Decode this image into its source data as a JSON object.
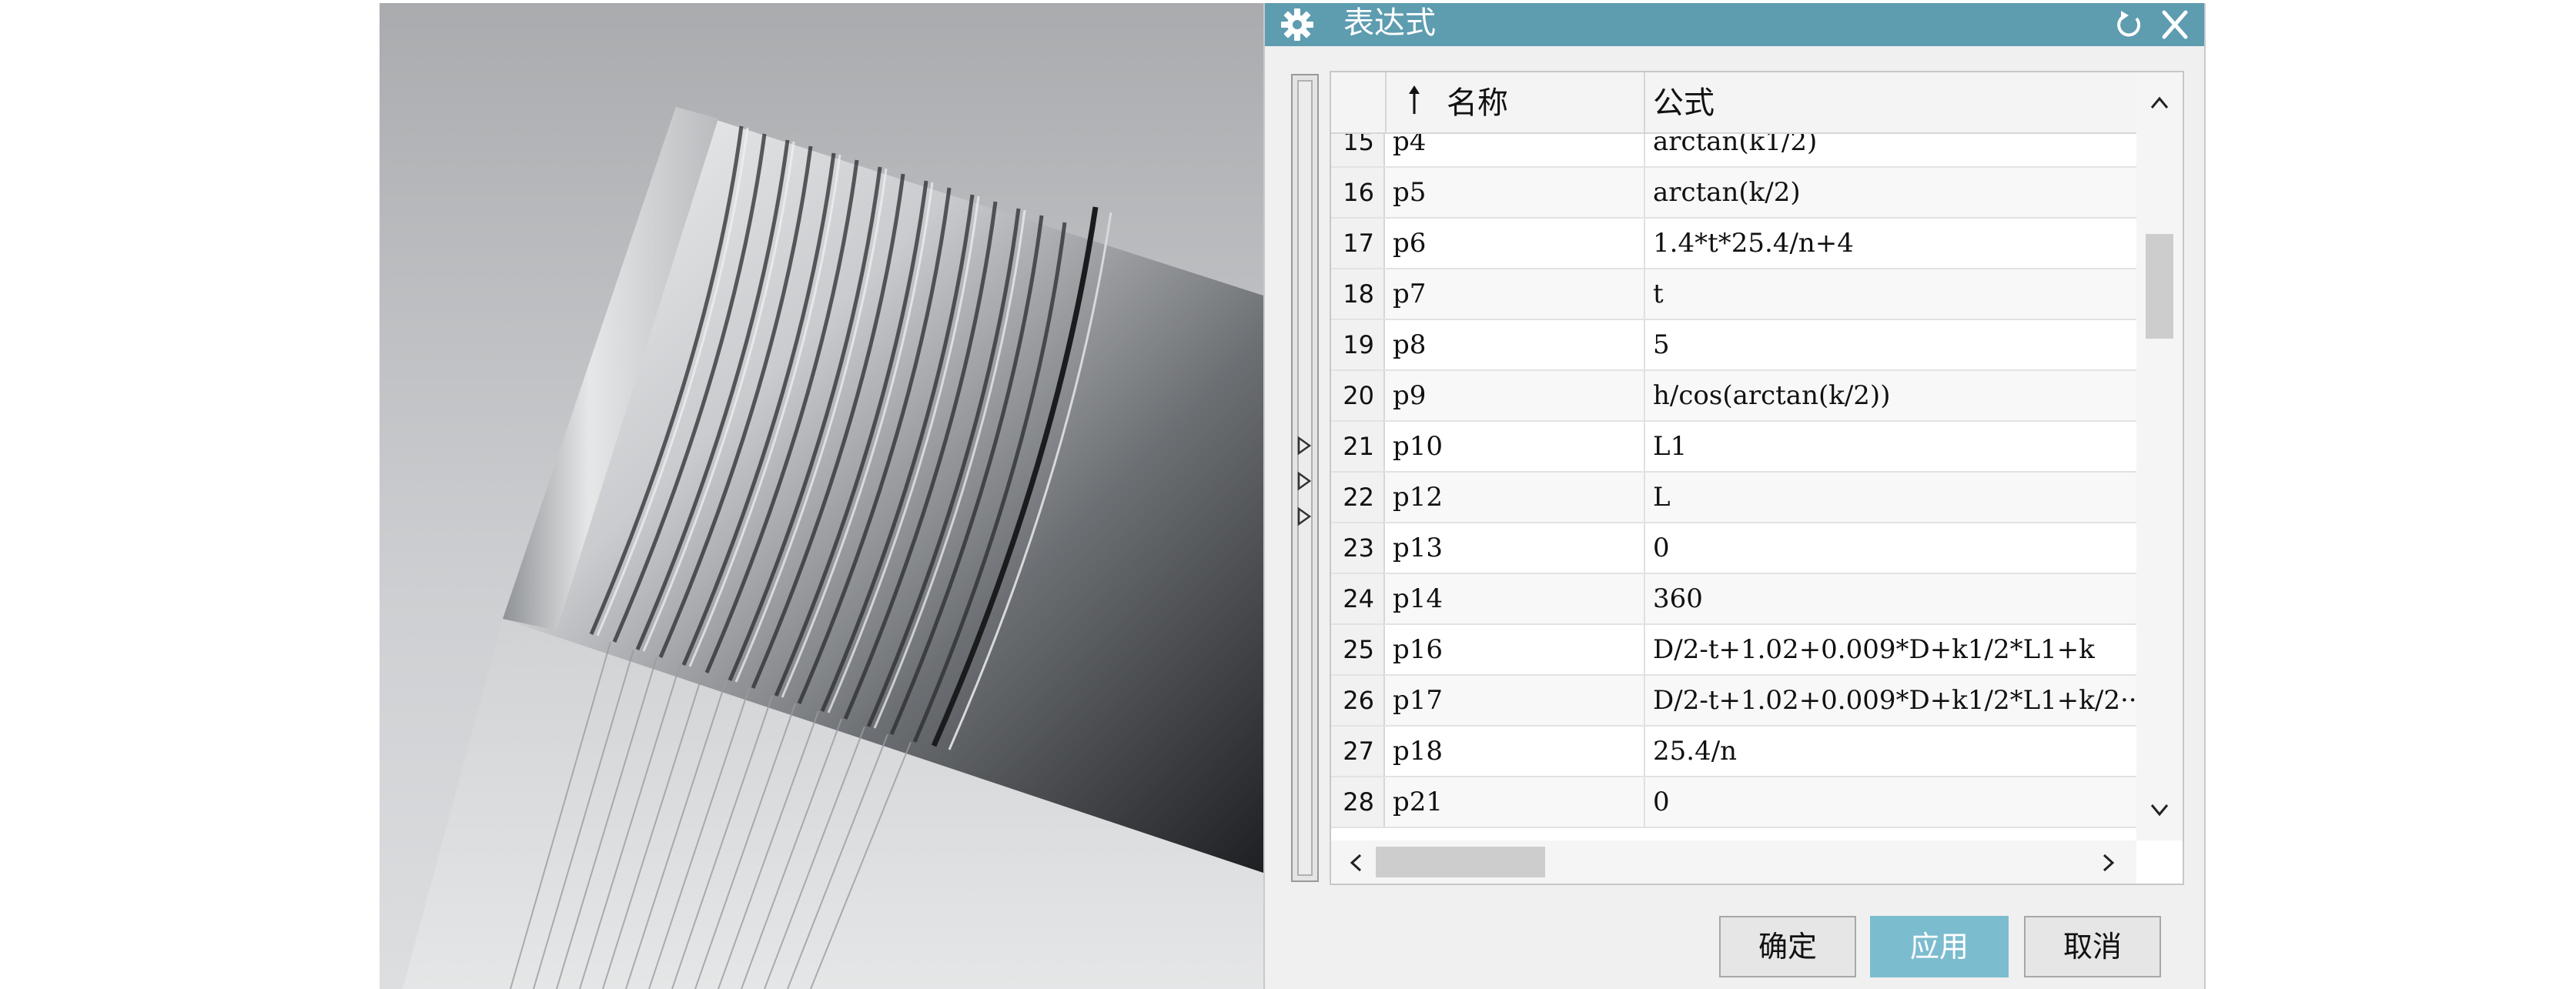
{
  "dialog": {
    "title": "表达式",
    "icons": {
      "title": "gear-icon",
      "reset": "reset-icon",
      "close": "close-icon"
    }
  },
  "table": {
    "columns": {
      "number": "",
      "name": "名称",
      "formula": "公式"
    },
    "sort_indicator": "sort-ascending-arrow",
    "rows": [
      {
        "num": "15",
        "name": "p4",
        "formula": "arctan(k1/2)"
      },
      {
        "num": "16",
        "name": "p5",
        "formula": "arctan(k/2)"
      },
      {
        "num": "17",
        "name": "p6",
        "formula": "1.4*t*25.4/n+4"
      },
      {
        "num": "18",
        "name": "p7",
        "formula": "t"
      },
      {
        "num": "19",
        "name": "p8",
        "formula": "5"
      },
      {
        "num": "20",
        "name": "p9",
        "formula": "h/cos(arctan(k/2))"
      },
      {
        "num": "21",
        "name": "p10",
        "formula": "L1"
      },
      {
        "num": "22",
        "name": "p12",
        "formula": "L"
      },
      {
        "num": "23",
        "name": "p13",
        "formula": "0"
      },
      {
        "num": "24",
        "name": "p14",
        "formula": "360"
      },
      {
        "num": "25",
        "name": "p16",
        "formula": "D/2-t+1.02+0.009*D+k1/2*L1+k"
      },
      {
        "num": "26",
        "name": "p17",
        "formula": "D/2-t+1.02+0.009*D+k1/2*L1+k/2··"
      },
      {
        "num": "27",
        "name": "p18",
        "formula": "25.4/n"
      },
      {
        "num": "28",
        "name": "p21",
        "formula": "0"
      }
    ]
  },
  "buttons": {
    "ok": "确定",
    "apply": "应用",
    "cancel": "取消"
  },
  "colors": {
    "titlebar": "#5e9cb0",
    "apply_button": "#7cbccf",
    "dialog_bg": "#f0f0f0"
  }
}
